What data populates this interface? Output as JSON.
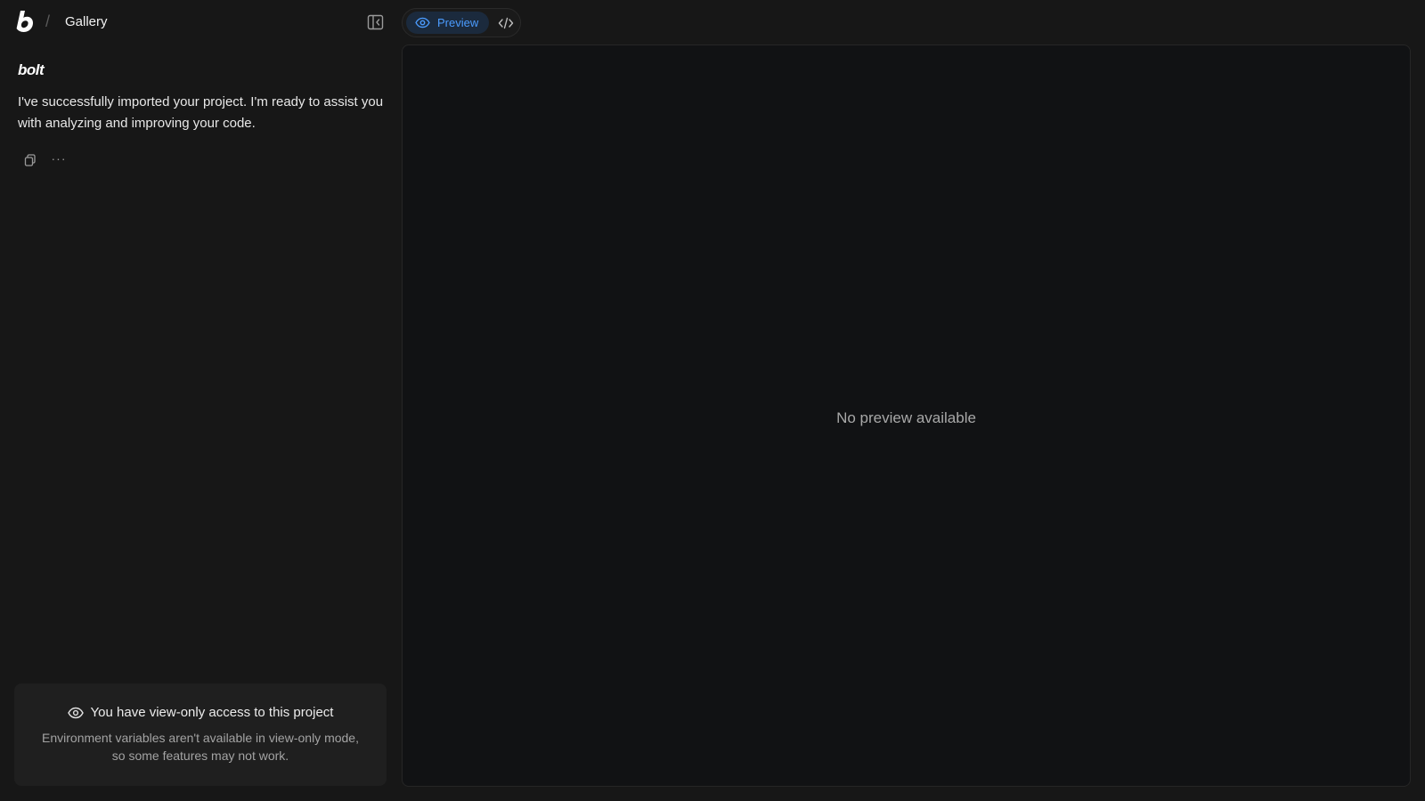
{
  "header": {
    "breadcrumb_separator": "/",
    "project_title": "Gallery"
  },
  "chat": {
    "wordmark": "bolt",
    "message": "I've successfully imported your project. I'm ready to assist you with analyzing and improving your code.",
    "more_actions": "···"
  },
  "notice": {
    "title": "You have view-only access to this project",
    "body": "Environment variables aren't available in view-only mode, so some features may not work."
  },
  "workbench": {
    "tabs": [
      {
        "label": "Preview",
        "active": true
      },
      {
        "label": "",
        "icon": "code-icon",
        "active": false
      }
    ],
    "empty_message": "No preview available"
  },
  "colors": {
    "background": "#171717",
    "preview_background": "#111214",
    "accent": "#4b9cff"
  }
}
